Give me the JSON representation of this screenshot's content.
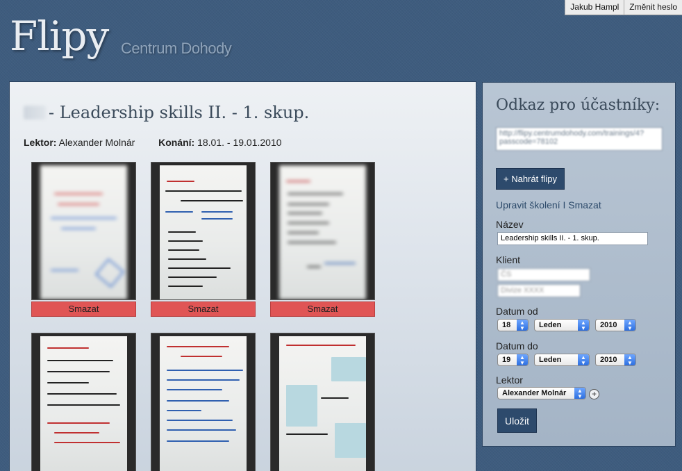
{
  "userbar": {
    "user_name": "Jakub Hampl",
    "change_password": "Změnit heslo"
  },
  "brand": {
    "logo": "Flipy",
    "subtitle": "Centrum Dohody"
  },
  "training": {
    "title": "- Leadership skills II. - 1. skup.",
    "lecturer_label": "Lektor:",
    "lecturer_name": "Alexander Molnár",
    "date_label": "Konání:",
    "date_value": "18.01. - 19.01.2010"
  },
  "thumbnails": {
    "delete_label": "Smazat",
    "items": [
      {
        "handwriting_color": "#d04040"
      },
      {
        "handwriting_color": "#c03030"
      },
      {
        "handwriting_color": "#c03030"
      },
      {
        "handwriting_color": "#c03030"
      },
      {
        "handwriting_color": "#c03030"
      },
      {
        "handwriting_color": "#d04040"
      }
    ]
  },
  "sidebar": {
    "heading": "Odkaz pro účastníky:",
    "link_url": "http://flipy.centrumdohody.com/trainings/4?passcode=78102",
    "upload_button": "+ Nahrát flipy",
    "edit_link": "Upravit školení",
    "separator": "I",
    "delete_link": "Smazat",
    "name_label": "Název",
    "name_value": "Leadership skills II. - 1. skup.",
    "client_label": "Klient",
    "client_value_1": "ČS",
    "client_value_2": "Divize XXXX",
    "date_from_label": "Datum od",
    "date_from": {
      "day": "18",
      "month": "Leden",
      "year": "2010"
    },
    "date_to_label": "Datum do",
    "date_to": {
      "day": "19",
      "month": "Leden",
      "year": "2010"
    },
    "lecturer_label": "Lektor",
    "lecturer_value": "Alexander Molnár",
    "add_lecturer": "+",
    "save_button": "Uložit"
  },
  "colors": {
    "background": "#3e5c7e",
    "delete": "#e05555",
    "button": "#2d4a6c"
  }
}
